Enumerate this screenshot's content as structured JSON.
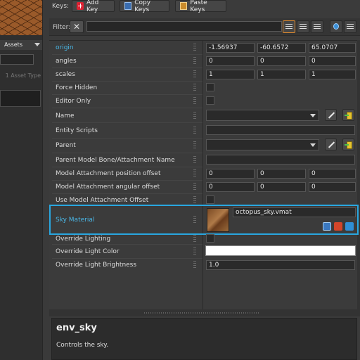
{
  "left_panel": {
    "tab_label": "Assets",
    "asset_type_label": "1 Asset Type"
  },
  "toolbar": {
    "keys_label": "Keys:",
    "add_key": "Add Key",
    "copy_keys": "Copy Keys",
    "paste_keys": "Paste Keys"
  },
  "filter": {
    "label": "Filter:",
    "value": ""
  },
  "properties": {
    "origin": {
      "label": "origin",
      "x": "-1.56937",
      "y": "-60.6572",
      "z": "65.0707"
    },
    "angles": {
      "label": "angles",
      "x": "0",
      "y": "0",
      "z": "0"
    },
    "scales": {
      "label": "scales",
      "x": "1",
      "y": "1",
      "z": "1"
    },
    "force_hidden": {
      "label": "Force Hidden"
    },
    "editor_only": {
      "label": "Editor Only"
    },
    "name": {
      "label": "Name"
    },
    "entity_scripts": {
      "label": "Entity Scripts"
    },
    "parent": {
      "label": "Parent"
    },
    "parent_model_bone": {
      "label": "Parent Model Bone/Attachment Name"
    },
    "attach_pos": {
      "label": "Model Attachment position offset",
      "x": "0",
      "y": "0",
      "z": "0"
    },
    "attach_ang": {
      "label": "Model Attachment angular offset",
      "x": "0",
      "y": "0",
      "z": "0"
    },
    "use_attach_offset": {
      "label": "Use Model Attachment Offset"
    },
    "sky_material": {
      "label": "Sky Material",
      "value": "octopus_sky.vmat"
    },
    "override_lighting": {
      "label": "Override Lighting"
    },
    "override_light_color": {
      "label": "Override Light Color",
      "color": "#ffffff"
    },
    "override_light_brightness": {
      "label": "Override Light Brightness",
      "value": "1.0"
    }
  },
  "description": {
    "title": "env_sky",
    "text": "Controls the sky."
  },
  "colors": {
    "highlight": "#29a7e0",
    "active_filter": "#e08a2e"
  }
}
